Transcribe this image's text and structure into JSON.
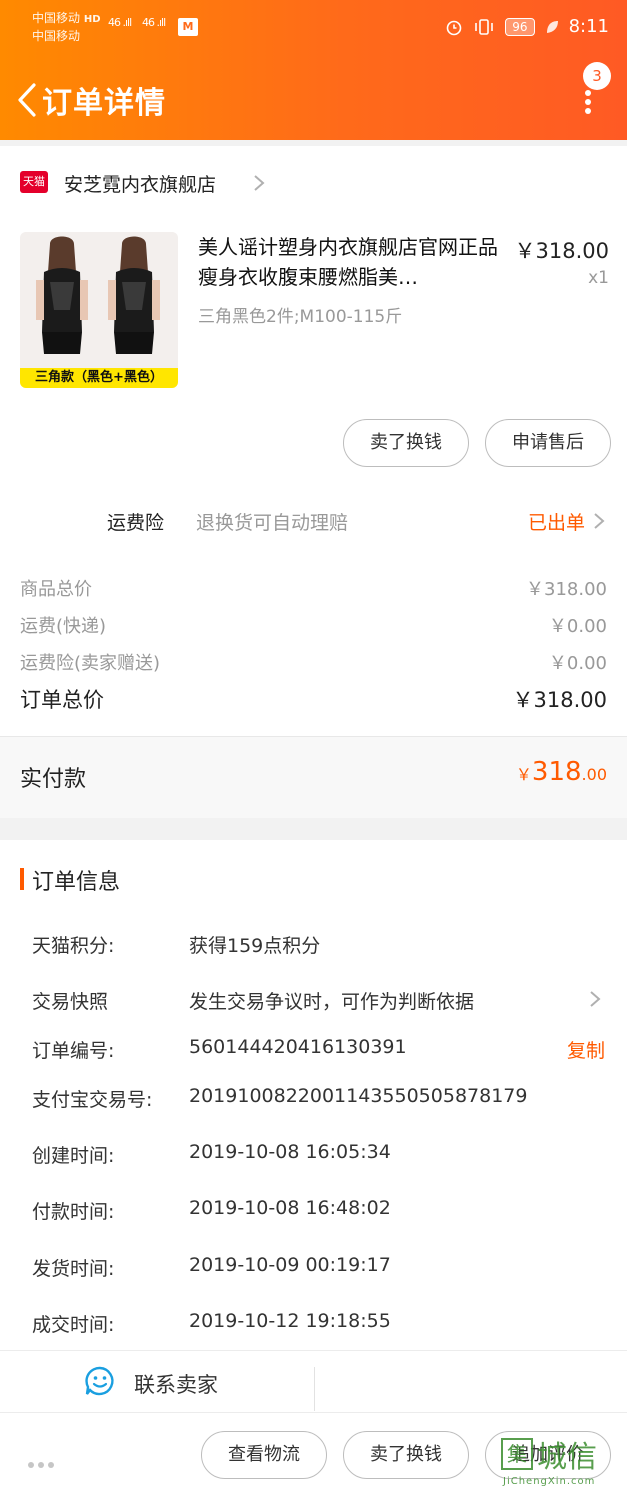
{
  "status_bar": {
    "carrier_1": "中国移动",
    "carrier_1_tag": "HD",
    "carrier_2": "中国移动",
    "signal_1": "46 .ıll",
    "signal_2": "46 .ıll",
    "app_badge": "M",
    "battery": "96",
    "time": "8:11"
  },
  "header": {
    "title": "订单详情",
    "badge_count": "3",
    "icons": [
      "back-arrow-icon",
      "more-dots-icon"
    ]
  },
  "shop": {
    "logo_text": "天猫",
    "name": "安芝霓内衣旗舰店"
  },
  "item": {
    "title": "美人谣计塑身内衣旗舰店官网正品瘦身衣收腹束腰燃脂美…",
    "price": "￥318.00",
    "quantity": "x1",
    "sku": "三角黑色2件;M100-115斤",
    "image_band": "三角款（黑色+黑色）",
    "actions": [
      "卖了换钱",
      "申请售后"
    ]
  },
  "insurance": {
    "label": "运费险",
    "description": "退换货可自动理赔",
    "status": "已出单"
  },
  "fees": [
    {
      "label": "商品总价",
      "value": "￥318.00"
    },
    {
      "label": "运费(快递)",
      "value": "￥0.00"
    },
    {
      "label": "运费险(卖家赠送)",
      "value": "￥0.00"
    }
  ],
  "total": {
    "label": "订单总价",
    "value": "￥318.00"
  },
  "paid": {
    "label": "实付款",
    "currency": "￥",
    "integer": "318",
    "decimal": ".00"
  },
  "order_info": {
    "title": "订单信息",
    "rows": [
      {
        "label": "天猫积分:",
        "value": "获得159点积分"
      },
      {
        "label": "交易快照",
        "value": "发生交易争议时，可作为判断依据"
      },
      {
        "label": "订单编号:",
        "value": "560144420416130391"
      },
      {
        "label": "支付宝交易号:",
        "value": "2019100822001143550505878179"
      },
      {
        "label": "创建时间:",
        "value": "2019-10-08 16:05:34"
      },
      {
        "label": "付款时间:",
        "value": "2019-10-08 16:48:02"
      },
      {
        "label": "发货时间:",
        "value": "2019-10-09 00:19:17"
      },
      {
        "label": "成交时间:",
        "value": "2019-10-12 19:18:55"
      }
    ],
    "copy_label": "复制"
  },
  "contact": {
    "label": "联系卖家"
  },
  "bottom_actions": [
    "查看物流",
    "卖了换钱",
    "追加评价"
  ],
  "watermark": {
    "icon_char": "集",
    "text": "城信",
    "url": "JiChengXin.com"
  },
  "colors": {
    "accent": "#ff5a00",
    "header_gradient_start": "#ff8a00",
    "header_gradient_end": "#ff5a24",
    "tmall_red": "#e4002b"
  }
}
